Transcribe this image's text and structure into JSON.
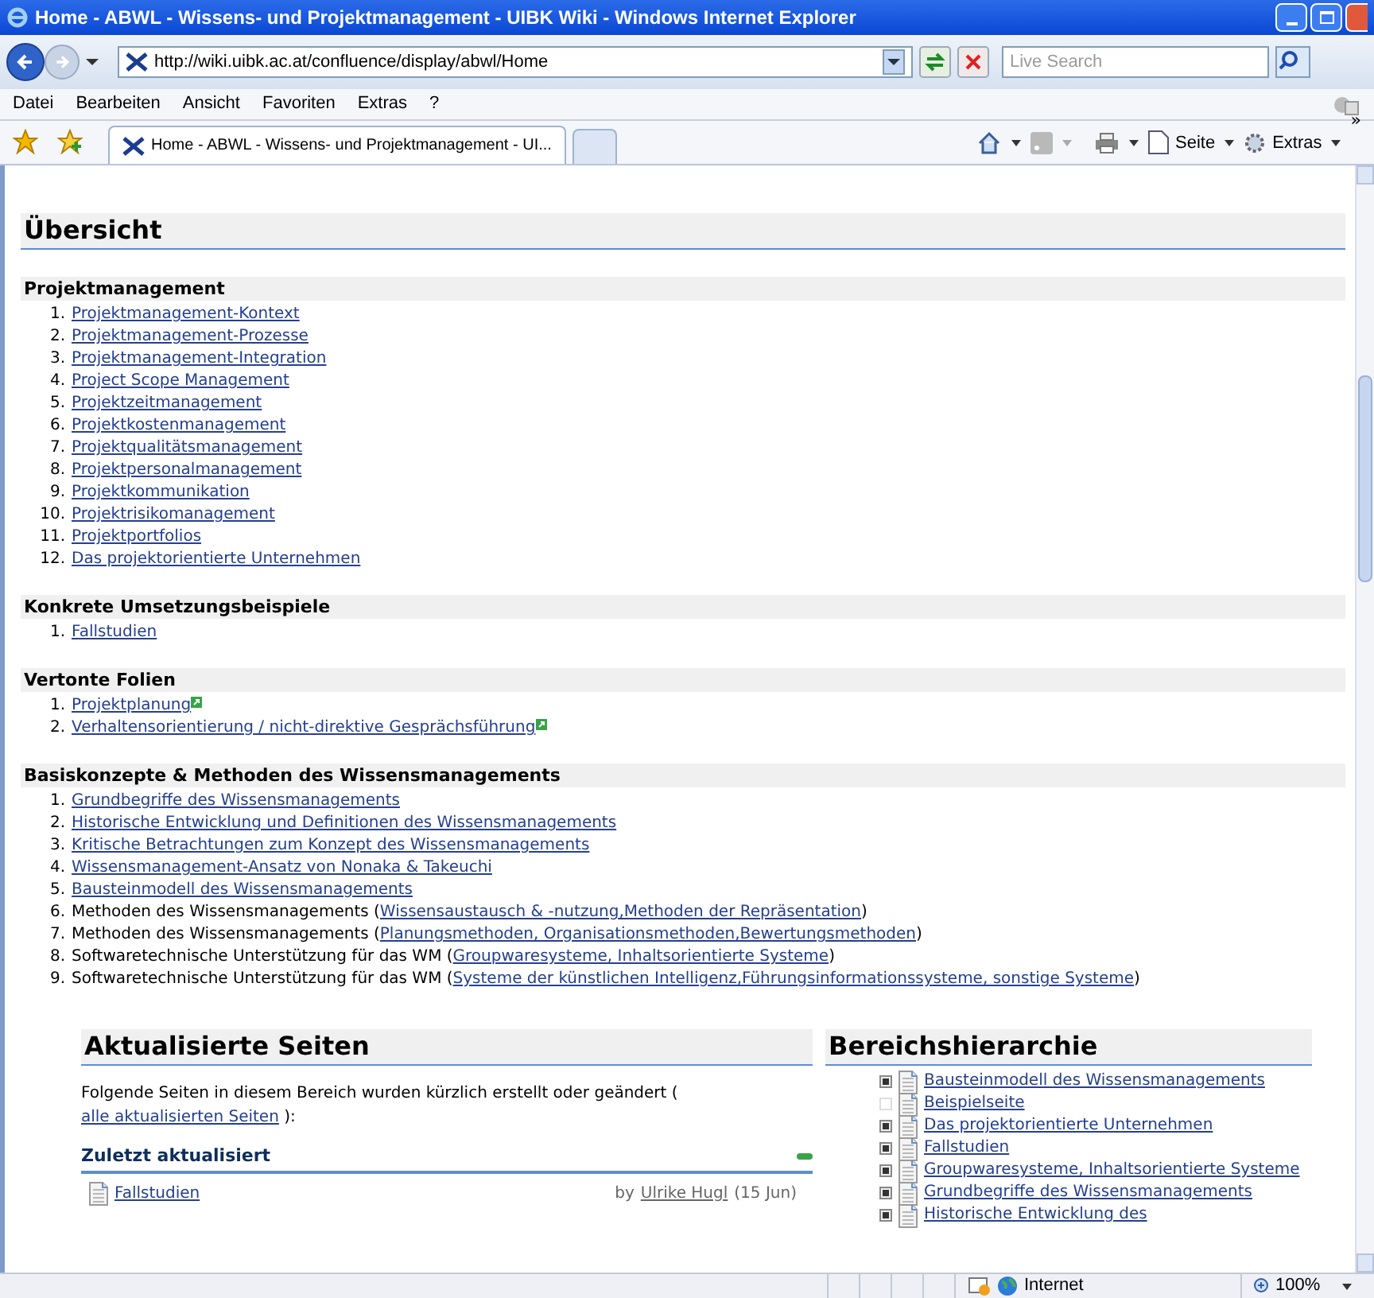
{
  "window": {
    "title": "Home - ABWL - Wissens- und Projektmanagement - UIBK Wiki - Windows Internet Explorer"
  },
  "address": {
    "url": "http://wiki.uibk.ac.at/confluence/display/abwl/Home"
  },
  "search": {
    "placeholder": "Live Search"
  },
  "menu": [
    "Datei",
    "Bearbeiten",
    "Ansicht",
    "Favoriten",
    "Extras",
    "?"
  ],
  "tabs": [
    {
      "label": "Home - ABWL - Wissens- und Projektmanagement - UI...",
      "selected": true
    }
  ],
  "command_bar": {
    "page": "Seite",
    "tools": "Extras",
    "more": "»"
  },
  "page": {
    "heading": "Übersicht",
    "sections": [
      {
        "title": "Projektmanagement",
        "items": [
          {
            "number": "1.",
            "link": "Projektmanagement-Kontext"
          },
          {
            "number": "2.",
            "link": "Projektmanagement-Prozesse"
          },
          {
            "number": "3.",
            "link": "Projektmanagement-Integration"
          },
          {
            "number": "4.",
            "link": "Project Scope Management"
          },
          {
            "number": "5.",
            "link": "Projektzeitmanagement"
          },
          {
            "number": "6.",
            "link": "Projektkostenmanagement"
          },
          {
            "number": "7.",
            "link": "Projektqualitätsmanagement"
          },
          {
            "number": "8.",
            "link": "Projektpersonalmanagement"
          },
          {
            "number": "9.",
            "link": "Projektkommunikation"
          },
          {
            "number": "10.",
            "link": "Projektrisikomanagement"
          },
          {
            "number": "11.",
            "link": "Projektportfolios"
          },
          {
            "number": "12.",
            "link": "Das projektorientierte Unternehmen"
          }
        ]
      },
      {
        "title": "Konkrete Umsetzungsbeispiele",
        "items": [
          {
            "number": "1.",
            "link": "Fallstudien"
          }
        ]
      },
      {
        "title": "Vertonte Folien",
        "items": [
          {
            "number": "1.",
            "link": "Projektplanung",
            "external": true
          },
          {
            "number": "2.",
            "link": "Verhaltensorientierung / nicht-direktive Gesprächsführung",
            "external": true
          }
        ]
      },
      {
        "title": "Basiskonzepte & Methoden des Wissensmanagements",
        "items": [
          {
            "number": "1.",
            "link": "Grundbegriffe des Wissensmanagements"
          },
          {
            "number": "2.",
            "link": "Historische Entwicklung und Definitionen des Wissensmanagements"
          },
          {
            "number": "3.",
            "link": "Kritische Betrachtungen zum Konzept des Wissensmanagements"
          },
          {
            "number": "4.",
            "link": "Wissensmanagement-Ansatz von Nonaka & Takeuchi"
          },
          {
            "number": "5.",
            "link": "Bausteinmodell des Wissensmanagements"
          },
          {
            "number": "6.",
            "prefix": "Methoden des Wissensmanagements (",
            "link": "Wissensaustausch & -nutzung,Methoden der Repräsentation",
            "suffix": ")"
          },
          {
            "number": "7.",
            "prefix": "Methoden des Wissensmanagements (",
            "link": "Planungsmethoden, Organisationsmethoden,Bewertungsmethoden",
            "suffix": ")"
          },
          {
            "number": "8.",
            "prefix": "Softwaretechnische Unterstützung für das WM (",
            "link": "Groupwaresysteme, Inhaltsorientierte Systeme",
            "suffix": ")"
          },
          {
            "number": "9.",
            "prefix": "Softwaretechnische Unterstützung für das WM (",
            "link": "Systeme der künstlichen Intelligenz,Führungsinformationssysteme, sonstige Systeme",
            "suffix": ")"
          }
        ]
      }
    ],
    "updated": {
      "heading": "Aktualisierte Seiten",
      "intro": "Folgende Seiten in diesem Bereich wurden kürzlich erstellt oder geändert (",
      "intro_link": "alle aktualisierten Seiten",
      "intro_end": "):",
      "subheading": "Zuletzt aktualisiert",
      "entries": [
        {
          "title": "Fallstudien",
          "by": "by",
          "author": "Ulrike Hugl",
          "date": "(15 Jun)"
        }
      ]
    },
    "hierarchy": {
      "heading": "Bereichshierarchie",
      "items": [
        {
          "title": "Bausteinmodell des Wissensmanagements",
          "has_children": true
        },
        {
          "title": "Beispielseite",
          "has_children": false
        },
        {
          "title": "Das projektorientierte Unternehmen",
          "has_children": true
        },
        {
          "title": "Fallstudien",
          "has_children": true
        },
        {
          "title": "Groupwaresysteme, Inhaltsorientierte Systeme",
          "has_children": true
        },
        {
          "title": "Grundbegriffe des Wissensmanagements",
          "has_children": true
        },
        {
          "title": "Historische Entwicklung des",
          "has_children": true
        }
      ]
    }
  },
  "status_bar": {
    "zone": "Internet",
    "zoom": "100%"
  }
}
